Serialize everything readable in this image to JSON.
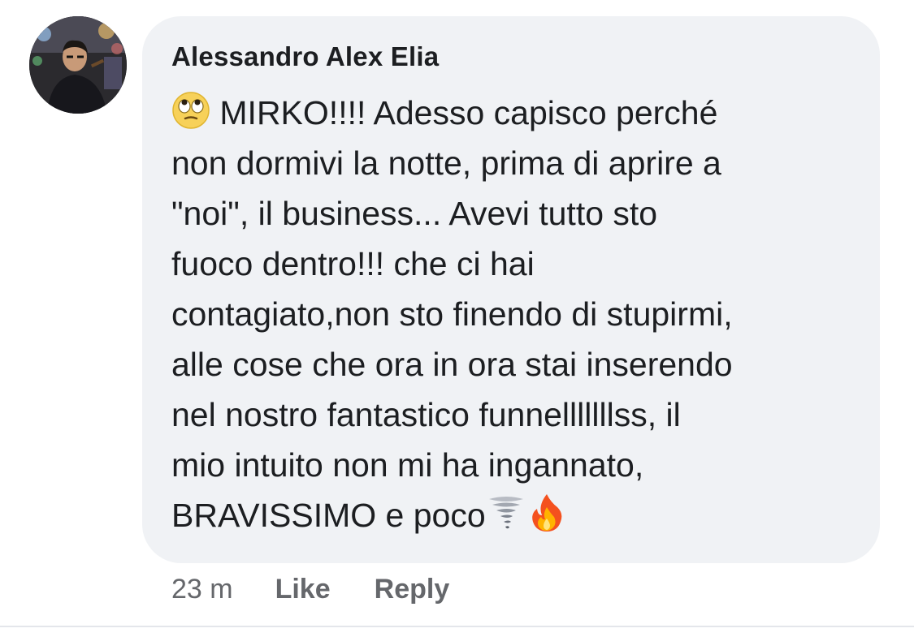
{
  "comment": {
    "author": "Alessandro Alex Elia",
    "avatar_icon": "profile-photo",
    "leading_emoji": "face-with-rolling-eyes-icon",
    "lines": [
      "MIRKO!!!! Adesso capisco perché",
      "non dormivi la notte, prima di aprire a",
      "\"noi\", il business... Avevi tutto sto",
      "fuoco dentro!!! che ci hai",
      "contagiato,non sto finendo di stupirmi,",
      "alle cose che ora in ora stai inserendo",
      "nel nostro fantastico funnelllllllss, il",
      "mio intuito non mi ha ingannato,",
      "BRAVISSIMO e poco"
    ],
    "trailing_emojis": [
      "tornado-icon",
      "fire-icon"
    ]
  },
  "actions": {
    "time": "23 m",
    "like_label": "Like",
    "reply_label": "Reply"
  },
  "colors": {
    "bubble_bg": "#f0f2f5",
    "text": "#1c1e21",
    "secondary_text": "#65676b"
  }
}
